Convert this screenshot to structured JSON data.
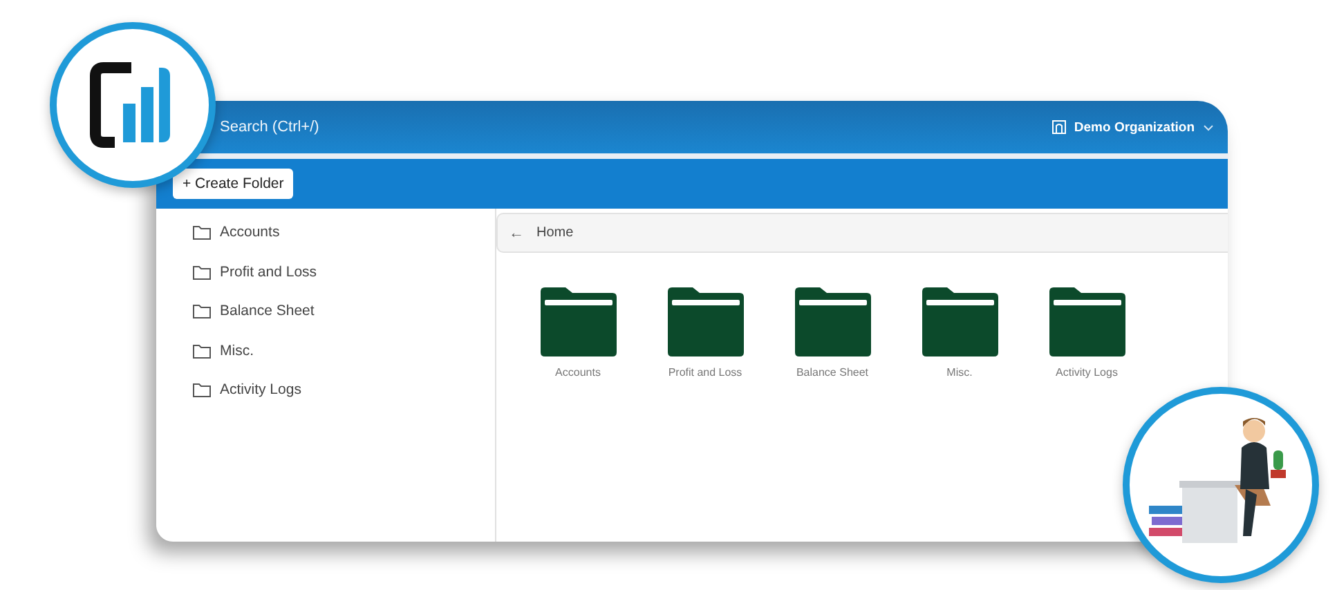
{
  "header": {
    "search_placeholder": "Search (Ctrl+/)",
    "organization": "Demo Organization"
  },
  "toolbar": {
    "create_button": "+ Create Folder"
  },
  "sidebar": {
    "items": [
      {
        "label": "Accounts"
      },
      {
        "label": "Profit and Loss"
      },
      {
        "label": "Balance Sheet"
      },
      {
        "label": "Misc."
      },
      {
        "label": "Activity Logs"
      }
    ]
  },
  "breadcrumb": {
    "back": "←",
    "label": "Home"
  },
  "folders": [
    {
      "label": "Accounts"
    },
    {
      "label": "Profit and Loss"
    },
    {
      "label": "Balance Sheet"
    },
    {
      "label": "Misc."
    },
    {
      "label": "Activity Logs"
    }
  ]
}
